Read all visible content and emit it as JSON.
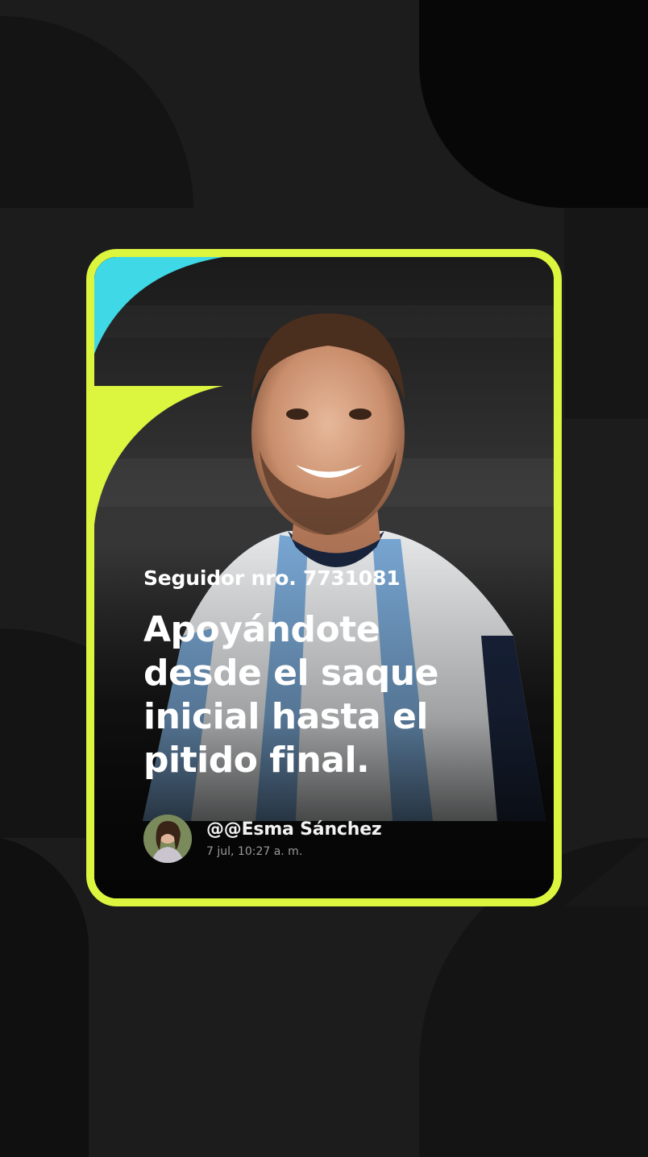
{
  "card": {
    "follower_label": "Seguidor nro. 7731081",
    "headline_lines": [
      "Apoyándote",
      "desde el saque",
      "inicial hasta el",
      "pitido final."
    ],
    "author_name": "@@Esma Sánchez",
    "timestamp": "7 jul, 10:27 a. m.",
    "accent_color": "#dcf53f",
    "accent_secondary": "#3fd8e6"
  }
}
